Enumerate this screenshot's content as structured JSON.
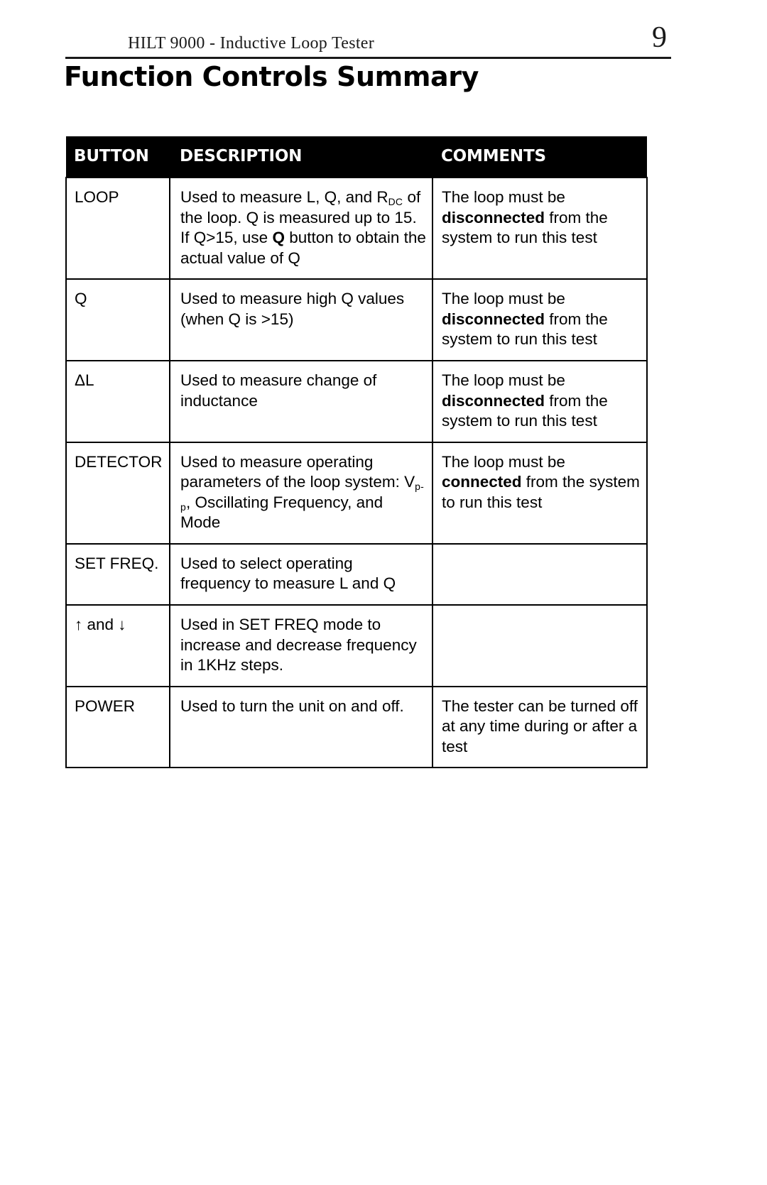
{
  "header": {
    "document_title": "HILT 9000 - Inductive Loop Tester",
    "page_number": "9"
  },
  "section": {
    "title": "Function Controls Summary"
  },
  "table": {
    "columns": [
      "BUTTON",
      "DESCRIPTION",
      "COMMENTS"
    ],
    "rows": [
      {
        "button": "LOOP",
        "description_parts": [
          {
            "t": "Used to measure L, Q, and R"
          },
          {
            "t": "DC",
            "sub": true
          },
          {
            "t": " of the loop. Q is measured up to 15.  If Q>15, use "
          },
          {
            "t": "Q",
            "bold": true
          },
          {
            "t": " button to obtain the actual value of Q"
          }
        ],
        "description_plain": "Used to measure L, Q, and RDC of the loop. Q is measured up to 15.  If Q>15, use Q button to obtain the actual value of Q",
        "comment_parts": [
          {
            "t": "The loop must be "
          },
          {
            "t": "disconnected",
            "bold": true
          },
          {
            "t": " from the system to run this test"
          }
        ],
        "comment_plain": "The loop must be disconnected from the system to run this test"
      },
      {
        "button": "Q",
        "description_parts": [
          {
            "t": "Used to measure high Q values (when Q is >15)"
          }
        ],
        "description_plain": "Used to measure high Q values (when Q is >15)",
        "comment_parts": [
          {
            "t": "The loop must be "
          },
          {
            "t": "disconnected",
            "bold": true
          },
          {
            "t": " from the system to run this test"
          }
        ],
        "comment_plain": "The loop must be disconnected from the system to run this test"
      },
      {
        "button": "ΔL",
        "description_parts": [
          {
            "t": "Used to measure change of inductance"
          }
        ],
        "description_plain": "Used to measure change of inductance",
        "comment_parts": [
          {
            "t": "The loop must be "
          },
          {
            "t": "disconnected",
            "bold": true
          },
          {
            "t": " from the system to run this test"
          }
        ],
        "comment_plain": "The loop must be disconnected from the system to run this test"
      },
      {
        "button": "DETECTOR",
        "description_parts": [
          {
            "t": "Used to measure operating parameters of the loop system: V"
          },
          {
            "t": "p-p",
            "sub": true
          },
          {
            "t": ", Oscillating Frequency, and Mode"
          }
        ],
        "description_plain": "Used to measure operating parameters of the loop system: Vp-p, Oscillating Frequency, and Mode",
        "comment_parts": [
          {
            "t": "The loop must be "
          },
          {
            "t": "connected",
            "bold": true
          },
          {
            "t": " from the system to run this test"
          }
        ],
        "comment_plain": "The loop must be connected from the system to run this test"
      },
      {
        "button": "SET FREQ.",
        "description_parts": [
          {
            "t": "Used to select operating frequency to measure L and Q"
          }
        ],
        "description_plain": "Used to select operating frequency to measure L and Q",
        "comment_parts": [],
        "comment_plain": ""
      },
      {
        "button": "↑ and ↓",
        "description_parts": [
          {
            "t": "Used in SET FREQ mode to increase and decrease frequency in 1KHz steps."
          }
        ],
        "description_plain": "Used in SET FREQ mode to increase and decrease frequency in 1KHz steps.",
        "comment_parts": [],
        "comment_plain": ""
      },
      {
        "button": "POWER",
        "description_parts": [
          {
            "t": "Used to turn the unit on and off."
          }
        ],
        "description_plain": "Used to turn the unit on and off.",
        "comment_parts": [
          {
            "t": "The tester can be turned off at any time during or after a test"
          }
        ],
        "comment_plain": "The tester can be turned off at any time during or after a test"
      }
    ]
  }
}
